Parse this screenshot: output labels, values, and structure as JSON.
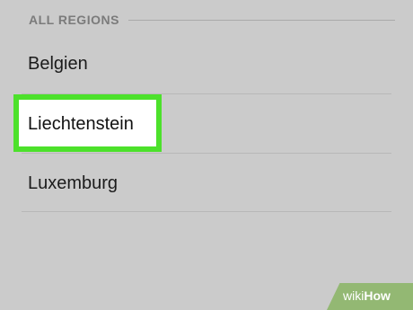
{
  "section": {
    "title": "ALL REGIONS"
  },
  "regions": [
    {
      "label": "Belgien"
    },
    {
      "label": "Liechtenstein"
    },
    {
      "label": "Luxemburg"
    }
  ],
  "selected_region": "Liechtenstein",
  "colors": {
    "background": "#cbcbcb",
    "highlight": "#4ce12b",
    "highlight_fill": "#ffffff",
    "watermark": "#93b873"
  },
  "watermark": {
    "part1": "wiki",
    "part2": "How"
  }
}
